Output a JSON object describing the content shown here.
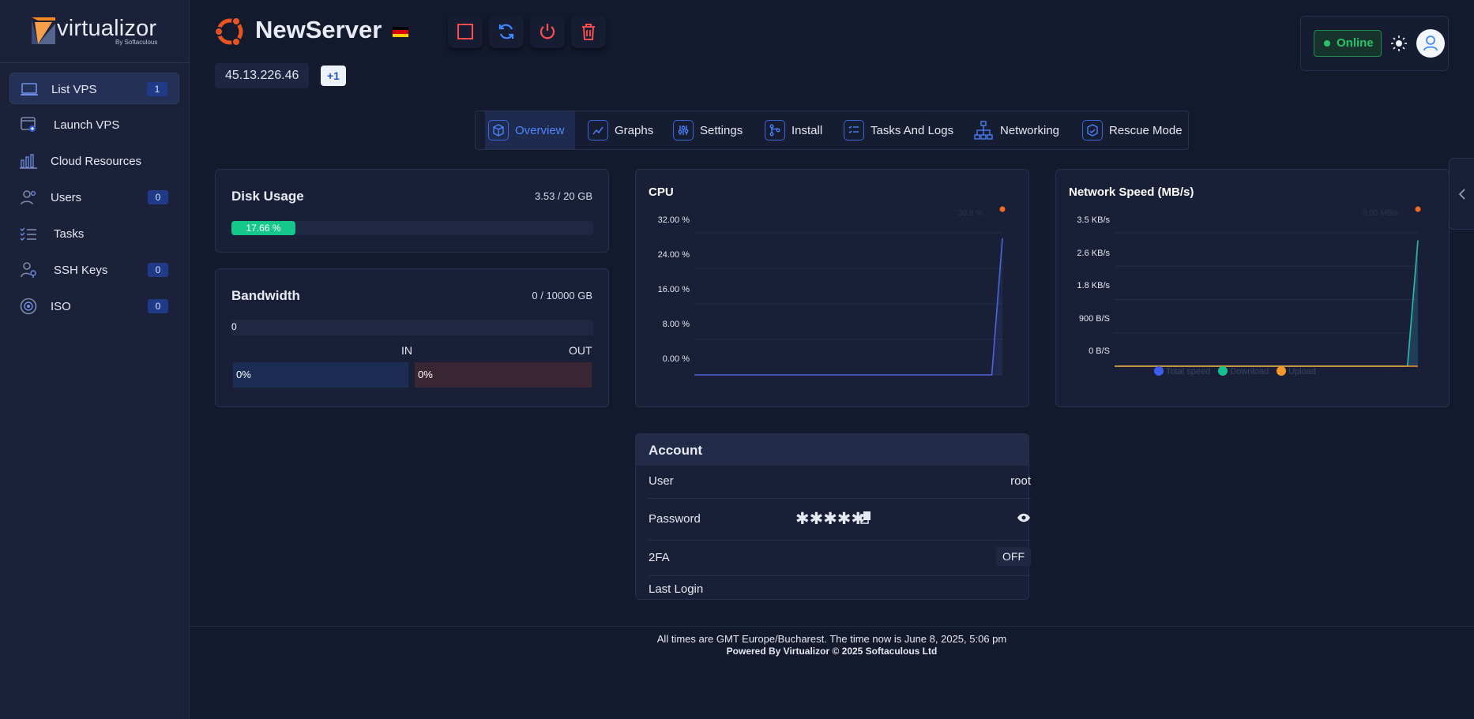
{
  "brand": {
    "name": "virtualizor",
    "by": "By Softaculous"
  },
  "sidebar": {
    "items": [
      {
        "label": "List VPS",
        "badge": "1",
        "icon": "laptop-icon"
      },
      {
        "label": "Launch VPS",
        "badge": null,
        "icon": "launch-window-icon"
      },
      {
        "label": "Cloud Resources",
        "badge": null,
        "icon": "bar-chart-icon"
      },
      {
        "label": "Users",
        "badge": "0",
        "icon": "users-icon"
      },
      {
        "label": "Tasks",
        "badge": null,
        "icon": "task-list-icon"
      },
      {
        "label": "SSH Keys",
        "badge": "0",
        "icon": "user-key-icon"
      },
      {
        "label": "ISO",
        "badge": "0",
        "icon": "disc-icon"
      }
    ]
  },
  "server": {
    "name": "NewServer",
    "ip": "45.13.226.46",
    "extra_ips": "+1",
    "flag_colors": [
      "#000000",
      "#dd0000",
      "#ffce00"
    ]
  },
  "status": {
    "label": "Online"
  },
  "tabs": [
    {
      "label": "Overview"
    },
    {
      "label": "Graphs"
    },
    {
      "label": "Settings"
    },
    {
      "label": "Install"
    },
    {
      "label": "Tasks And Logs"
    },
    {
      "label": "Networking"
    },
    {
      "label": "Rescue Mode"
    }
  ],
  "disk": {
    "title": "Disk Usage",
    "value": "3.53 / 20 GB",
    "percent_label": "17.66 %",
    "percent": 17.66
  },
  "bandwidth": {
    "title": "Bandwidth",
    "value": "0 / 10000 GB",
    "bar_label": "0",
    "in_label": "IN",
    "out_label": "OUT",
    "in_pct": "0%",
    "out_pct": "0%"
  },
  "cpu": {
    "title": "CPU",
    "yticks": [
      "32.00 %",
      "24.00 %",
      "16.00 %",
      "8.00 %",
      "0.00 %"
    ],
    "marker": "30.8 %"
  },
  "network": {
    "title": "Network Speed (MB/s)",
    "yticks": [
      "3.5 KB/s",
      "2.6 KB/s",
      "1.8 KB/s",
      "900 B/S",
      "0 B/S"
    ],
    "marker": "0.00 MB/s",
    "legend": [
      "Total speed",
      "Download",
      "Upload"
    ]
  },
  "account": {
    "title": "Account",
    "user_label": "User",
    "user_value": "root",
    "password_label": "Password",
    "password_value": "✱✱✱✱✱",
    "twofa_label": "2FA",
    "twofa_value": "OFF",
    "last_login_label": "Last Login"
  },
  "footer": {
    "line1": "All times are GMT Europe/Bucharest. The time now is June 8, 2025, 5:06 pm",
    "line2": "Powered By Virtualizor © 2025 Softaculous Ltd"
  },
  "colors": {
    "accent": "#4d86ff",
    "success": "#15c78b",
    "danger": "#ff4d4d",
    "cpu_line": "#4b66d9",
    "download_line": "#2ab7a0",
    "upload": "#f59a2a",
    "marker": "#f46a21"
  },
  "chart_data": [
    {
      "type": "line",
      "title": "CPU",
      "ylabel": "",
      "ylim": [
        0,
        32
      ],
      "yticks": [
        "32.00 %",
        "24.00 %",
        "16.00 %",
        "8.00 %",
        "0.00 %"
      ],
      "series": [
        {
          "name": "",
          "values": [
            0,
            0,
            0,
            0,
            0,
            0,
            0,
            0,
            0,
            0,
            0,
            0,
            0,
            0,
            0,
            0,
            0,
            0,
            0,
            0,
            0,
            0,
            0,
            0,
            0,
            0,
            0,
            0,
            0,
            30.8
          ]
        }
      ]
    },
    {
      "type": "line",
      "title": "Network Speed (MB/s)",
      "ylim": [
        0,
        3.5
      ],
      "yticks": [
        "3.5 KB/s",
        "2.6 KB/s",
        "1.8 KB/s",
        "900 B/S",
        "0 B/S"
      ],
      "legend": [
        "Total speed",
        "Download",
        "Upload"
      ],
      "series": [
        {
          "name": "Total speed",
          "values": [
            0,
            0,
            0,
            0,
            0,
            0,
            0,
            0,
            0,
            0,
            0,
            0,
            0,
            0,
            0,
            0,
            0,
            0,
            0,
            0,
            0,
            0,
            0,
            0,
            0,
            0,
            0,
            0,
            0,
            3.3
          ]
        },
        {
          "name": "Download",
          "values": [
            0,
            0,
            0,
            0,
            0,
            0,
            0,
            0,
            0,
            0,
            0,
            0,
            0,
            0,
            0,
            0,
            0,
            0,
            0,
            0,
            0,
            0,
            0,
            0,
            0,
            0,
            0,
            0,
            0,
            3.3
          ]
        },
        {
          "name": "Upload",
          "values": [
            0,
            0,
            0,
            0,
            0,
            0,
            0,
            0,
            0,
            0,
            0,
            0,
            0,
            0,
            0,
            0,
            0,
            0,
            0,
            0,
            0,
            0,
            0,
            0,
            0,
            0,
            0,
            0,
            0,
            0
          ]
        }
      ]
    }
  ]
}
